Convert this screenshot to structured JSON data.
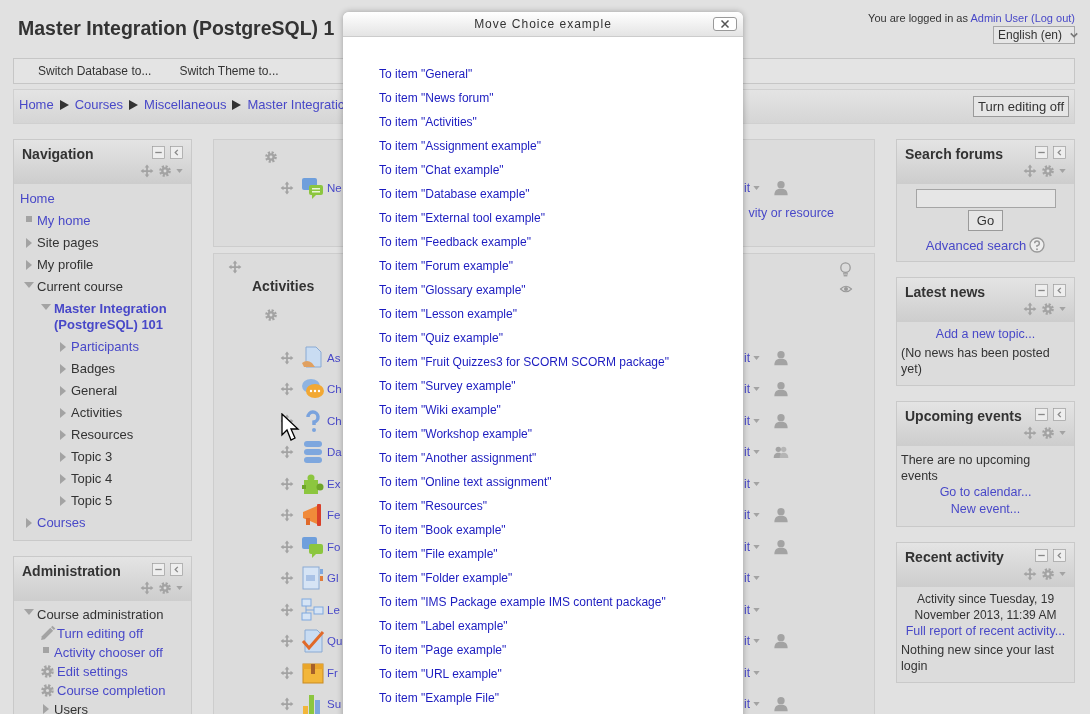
{
  "header": {
    "title": "Master Integration (PostgreSQL) 1",
    "login": {
      "before": "You are logged in as",
      "user": "Admin User",
      "logout": "(Log out)"
    },
    "language": "English (en)"
  },
  "menu": [
    "Switch Database to...",
    "Switch Theme to..."
  ],
  "breadcrumb": [
    "Home",
    "Courses",
    "Miscellaneous",
    "Master Integratic"
  ],
  "editing_button": "Turn editing off",
  "left_blocks": [
    {
      "title": "Navigation",
      "items": [
        {
          "label": "Home",
          "kind": "plain",
          "link": true
        },
        {
          "label": "My home",
          "kind": "leaf",
          "link": true
        },
        {
          "label": "Site pages",
          "kind": "branch",
          "link": false,
          "expanded": false
        },
        {
          "label": "My profile",
          "kind": "branch",
          "link": false,
          "expanded": false
        },
        {
          "label": "Current course",
          "kind": "branch",
          "link": false,
          "expanded": true,
          "children": [
            {
              "label": "Master Integration (PostgreSQL) 101",
              "kind": "course",
              "link": true,
              "expanded": true,
              "children": [
                {
                  "label": "Participants",
                  "kind": "branch",
                  "link": true,
                  "expanded": false
                },
                {
                  "label": "Badges",
                  "kind": "branch",
                  "link": false,
                  "expanded": false
                },
                {
                  "label": "General",
                  "kind": "branch",
                  "link": false,
                  "expanded": false
                },
                {
                  "label": "Activities",
                  "kind": "branch",
                  "link": false,
                  "expanded": false
                },
                {
                  "label": "Resources",
                  "kind": "branch",
                  "link": false,
                  "expanded": false
                },
                {
                  "label": "Topic 3",
                  "kind": "branch",
                  "link": false,
                  "expanded": false
                },
                {
                  "label": "Topic 4",
                  "kind": "branch",
                  "link": false,
                  "expanded": false
                },
                {
                  "label": "Topic 5",
                  "kind": "branch",
                  "link": false,
                  "expanded": false
                }
              ]
            }
          ]
        },
        {
          "label": "Courses",
          "kind": "branch",
          "link": true,
          "expanded": false
        }
      ]
    },
    {
      "title": "Administration",
      "items": [
        {
          "label": "Course administration",
          "kind": "branch",
          "link": false,
          "expanded": true,
          "children": [
            {
              "label": "Turn editing off",
              "kind": "pencil",
              "link": true
            },
            {
              "label": "Activity chooser off",
              "kind": "leaf",
              "link": true
            },
            {
              "label": "Edit settings",
              "kind": "gear",
              "link": true
            },
            {
              "label": "Course completion",
              "kind": "gear",
              "link": true
            },
            {
              "label": "Users",
              "kind": "branch",
              "link": false,
              "expanded": false
            }
          ]
        }
      ]
    }
  ],
  "sections": [
    {
      "kind": "general",
      "rows": [
        {
          "name": "Ne",
          "edit": "it",
          "has_group_mode": true,
          "separate_groups": false
        }
      ],
      "add_link": "vity or resource"
    },
    {
      "kind": "topic",
      "title": "Activities",
      "rows": [
        {
          "name": "As",
          "edit": "it",
          "has_group_mode": true,
          "separate_groups": false
        },
        {
          "name": "Ch",
          "edit": "it",
          "has_group_mode": true,
          "separate_groups": false
        },
        {
          "name": "Ch",
          "edit": "it",
          "has_group_mode": true,
          "separate_groups": false
        },
        {
          "name": "Da",
          "edit": "it",
          "has_group_mode": true,
          "separate_groups": true
        },
        {
          "name": "Ex",
          "edit": "it",
          "has_group_mode": false
        },
        {
          "name": "Fe",
          "edit": "it",
          "has_group_mode": true,
          "separate_groups": false
        },
        {
          "name": "Fo",
          "edit": "it",
          "has_group_mode": true,
          "separate_groups": false
        },
        {
          "name": "Gl",
          "edit": "it",
          "has_group_mode": false
        },
        {
          "name": "Le",
          "edit": "it",
          "has_group_mode": false
        },
        {
          "name": "Qu",
          "edit": "it",
          "has_group_mode": true,
          "separate_groups": false
        },
        {
          "name": "Fr",
          "edit": "it",
          "has_group_mode": false
        },
        {
          "name": "Su",
          "edit": "it",
          "has_group_mode": true,
          "separate_groups": false
        }
      ]
    }
  ],
  "right_blocks": [
    {
      "title": "Search forums",
      "content": [
        {
          "kind": "search-field"
        },
        {
          "kind": "button",
          "label": "Go"
        },
        {
          "kind": "help-link",
          "label": "Advanced search"
        }
      ]
    },
    {
      "title": "Latest news",
      "content": [
        {
          "kind": "center-link",
          "label": "Add a new topic..."
        },
        {
          "kind": "text",
          "label": "(No news has been posted yet)"
        }
      ]
    },
    {
      "title": "Upcoming events",
      "content": [
        {
          "kind": "text",
          "label": "There are no upcoming events"
        },
        {
          "kind": "center-link",
          "label": "Go to calendar..."
        },
        {
          "kind": "center-link",
          "label": "New event..."
        }
      ]
    },
    {
      "title": "Recent activity",
      "content": [
        {
          "kind": "center-text",
          "label": "Activity since Tuesday, 19 November 2013, 11:39 AM"
        },
        {
          "kind": "center-link",
          "label": "Full report of recent activity..."
        },
        {
          "kind": "text",
          "label": "Nothing new since your last login"
        }
      ]
    }
  ],
  "dialog": {
    "title": "Move Choice example",
    "items": [
      "To item \"General\"",
      "To item \"News forum\"",
      "To item \"Activities\"",
      "To item \"Assignment example\"",
      "To item \"Chat example\"",
      "To item \"Database example\"",
      "To item \"External tool example\"",
      "To item \"Feedback example\"",
      "To item \"Forum example\"",
      "To item \"Glossary example\"",
      "To item \"Lesson example\"",
      "To item \"Quiz example\"",
      "To item \"Fruit Quizzes3 for SCORM SCORM package\"",
      "To item \"Survey example\"",
      "To item \"Wiki example\"",
      "To item \"Workshop example\"",
      "To item \"Another assignment\"",
      "To item \"Online text assignment\"",
      "To item \"Resources\"",
      "To item \"Book example\"",
      "To item \"File example\"",
      "To item \"Folder example\"",
      "To item \"IMS Package example IMS content package\"",
      "To item \"Label example\"",
      "To item \"Page example\"",
      "To item \"URL example\"",
      "To item \"Example File\""
    ]
  }
}
